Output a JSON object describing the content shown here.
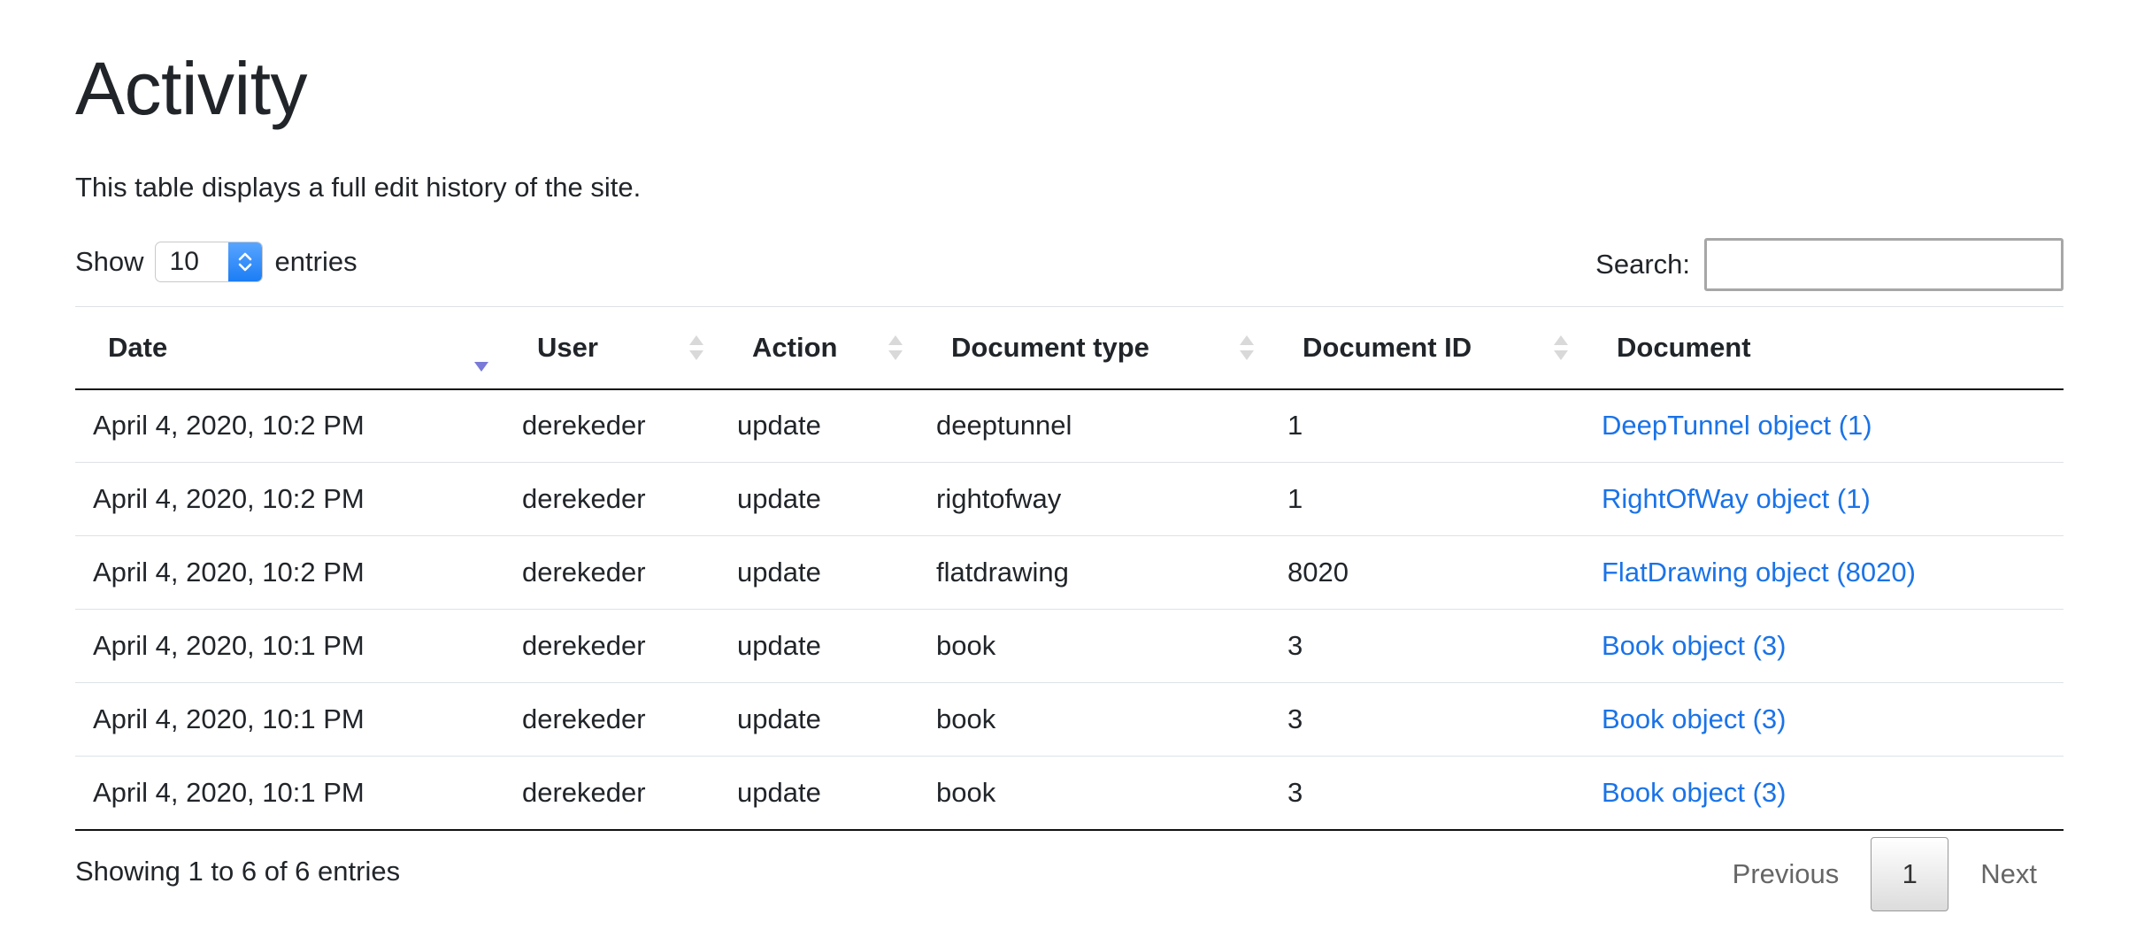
{
  "page": {
    "title": "Activity",
    "intro": "This table displays a full edit history of the site."
  },
  "length": {
    "prefix": "Show",
    "value": "10",
    "suffix": "entries"
  },
  "search": {
    "label": "Search:",
    "value": ""
  },
  "table": {
    "columns": [
      {
        "label": "Date",
        "sort": "desc"
      },
      {
        "label": "User",
        "sort": "none"
      },
      {
        "label": "Action",
        "sort": "none"
      },
      {
        "label": "Document type",
        "sort": "none"
      },
      {
        "label": "Document ID",
        "sort": "none"
      },
      {
        "label": "Document",
        "sort": "off"
      }
    ],
    "rows": [
      {
        "date": "April 4, 2020, 10:2 PM",
        "user": "derekeder",
        "action": "update",
        "doctype": "deeptunnel",
        "docid": "1",
        "document": "DeepTunnel object (1)"
      },
      {
        "date": "April 4, 2020, 10:2 PM",
        "user": "derekeder",
        "action": "update",
        "doctype": "rightofway",
        "docid": "1",
        "document": "RightOfWay object (1)"
      },
      {
        "date": "April 4, 2020, 10:2 PM",
        "user": "derekeder",
        "action": "update",
        "doctype": "flatdrawing",
        "docid": "8020",
        "document": "FlatDrawing object (8020)"
      },
      {
        "date": "April 4, 2020, 10:1 PM",
        "user": "derekeder",
        "action": "update",
        "doctype": "book",
        "docid": "3",
        "document": "Book object (3)"
      },
      {
        "date": "April 4, 2020, 10:1 PM",
        "user": "derekeder",
        "action": "update",
        "doctype": "book",
        "docid": "3",
        "document": "Book object (3)"
      },
      {
        "date": "April 4, 2020, 10:1 PM",
        "user": "derekeder",
        "action": "update",
        "doctype": "book",
        "docid": "3",
        "document": "Book object (3)"
      }
    ]
  },
  "footer": {
    "info": "Showing 1 to 6 of 6 entries",
    "previous": "Previous",
    "current_page": "1",
    "next": "Next"
  },
  "colors": {
    "link": "#1a73e8",
    "sort_active": "#7a7ad8",
    "stepper": "#1a7cf5"
  }
}
